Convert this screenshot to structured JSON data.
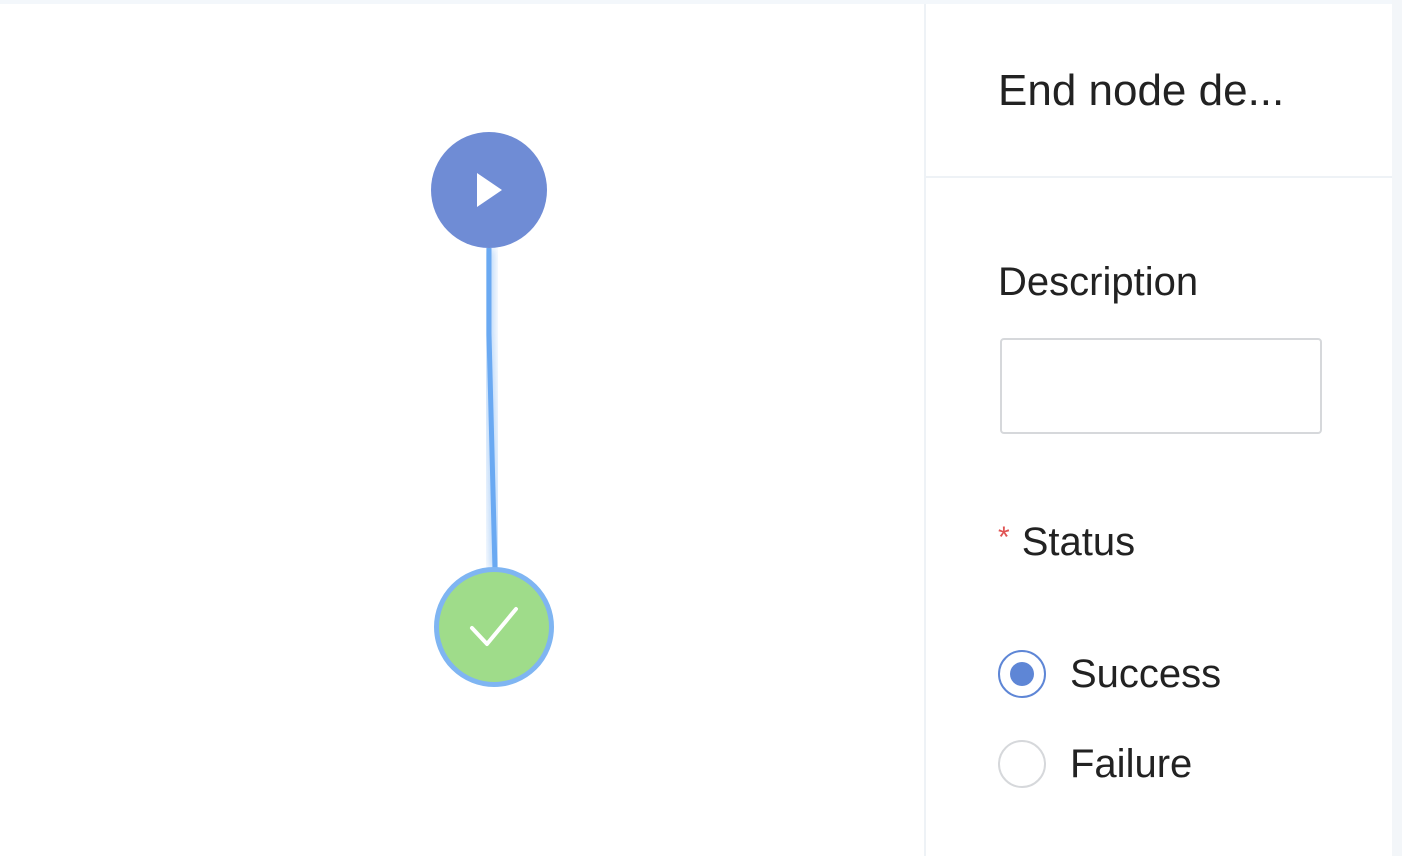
{
  "panel": {
    "title": "End node de...",
    "description_label": "Description",
    "description_value": "",
    "description_placeholder": "",
    "status_required_marker": "*",
    "status_label": "Status",
    "status_options": [
      {
        "label": "Success",
        "selected": true
      },
      {
        "label": "Failure",
        "selected": false
      }
    ]
  },
  "canvas": {
    "nodes": [
      {
        "type": "start",
        "icon": "play-icon",
        "color": "#6f8cd5"
      },
      {
        "type": "end",
        "icon": "check-icon",
        "color": "#9fdc8a",
        "selected": true
      }
    ],
    "edge_color": "#6aa9f2"
  }
}
